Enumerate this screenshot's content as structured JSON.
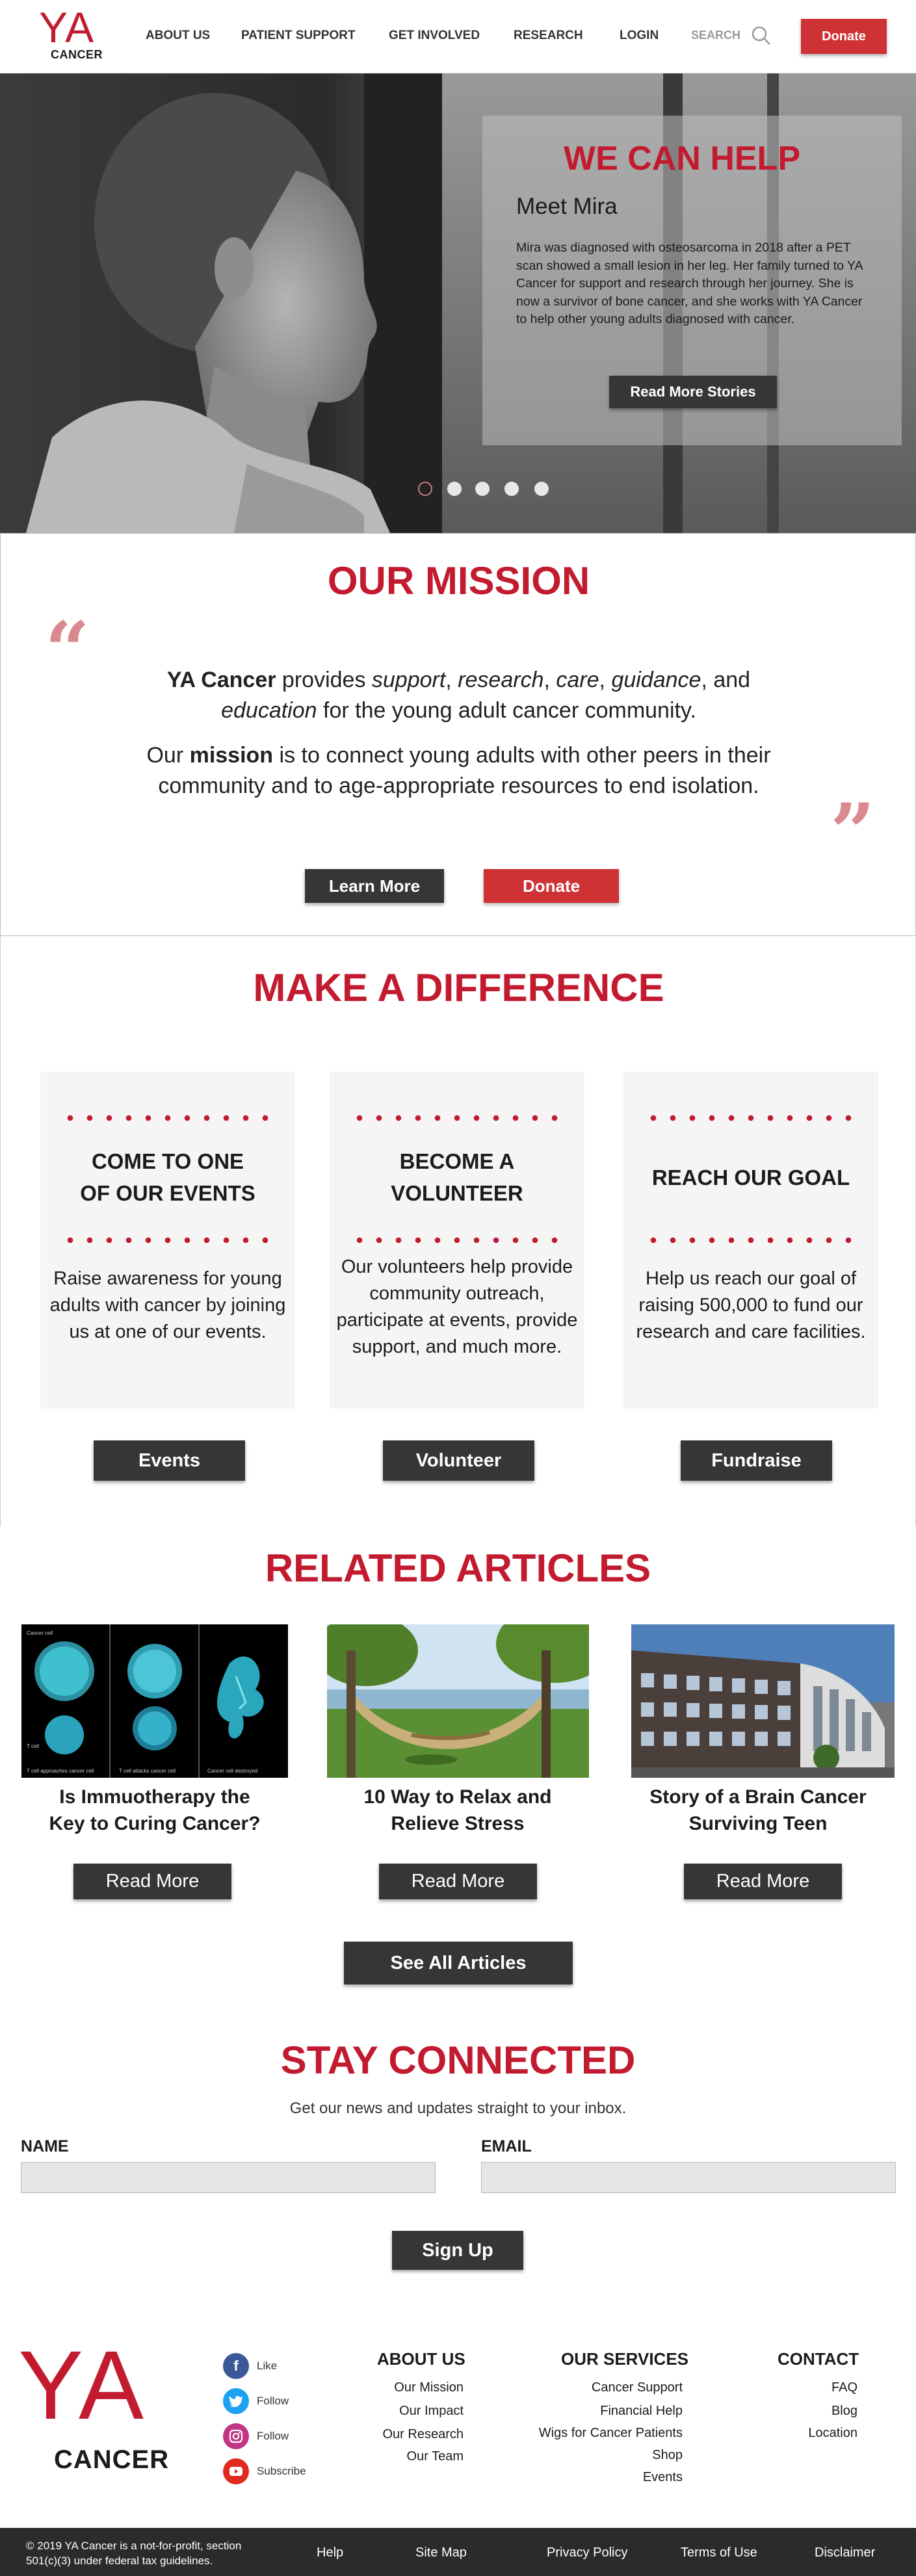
{
  "header": {
    "logo_ya": "YA",
    "logo_cancer": "CANCER",
    "nav": [
      "ABOUT US",
      "PATIENT SUPPORT",
      "GET INVOLVED",
      "RESEARCH",
      "LOGIN"
    ],
    "search_label": "SEARCH",
    "donate": "Donate"
  },
  "hero": {
    "headline": "WE CAN HELP",
    "subhead": "Meet Mira",
    "body": "Mira was diagnosed with osteosarcoma in 2018 after a PET scan showed a small lesion in her leg. Her family turned to YA Cancer for support and research through her journey. She is now a survivor of bone cancer, and she works with YA Cancer to help other young adults diagnosed with cancer.",
    "button": "Read More Stories",
    "slide_count": 5,
    "active_slide": 1
  },
  "mission": {
    "title": "OUR MISSION",
    "p1": {
      "brand": "YA Cancer",
      "t1": " provides ",
      "w1": "support",
      "s1": ", ",
      "w2": "research",
      "s2": ", ",
      "w3": "care",
      "s3": ", ",
      "w4": "guidance",
      "s4": ", and",
      "w5": "education",
      "t2": " for the young adult cancer community."
    },
    "p2": {
      "t1": "Our ",
      "bold": "mission",
      "t2": " is to connect young adults with other peers in their community and to age-appropriate resources to end isolation."
    },
    "learn_more": "Learn More",
    "donate": "Donate"
  },
  "difference": {
    "title": "MAKE A DIFFERENCE",
    "cards": [
      {
        "title_l1": "COME TO ONE",
        "title_l2": "OF OUR EVENTS",
        "text": "Raise awareness for young adults with cancer by joining us at one of our events.",
        "button": "Events"
      },
      {
        "title_l1": "BECOME A",
        "title_l2": "VOLUNTEER",
        "text": "Our volunteers help provide community outreach, participate at events, provide support, and much more.",
        "button": "Volunteer"
      },
      {
        "title_l1": "REACH OUR GOAL",
        "title_l2": "",
        "text": "Help us reach our goal of raising 500,000 to fund our research and care facilities.",
        "button": "Fundraise"
      }
    ]
  },
  "articles": {
    "title": "RELATED ARTICLES",
    "items": [
      {
        "title_l1": "Is Immuotherapy the",
        "title_l2": "Key to Curing Cancer?",
        "button": "Read More",
        "captions": [
          "Cancer cell",
          "T cell",
          "T cell approaches cancer cell",
          "T cell attacks cancer cell",
          "Cancer cell destroyed"
        ]
      },
      {
        "title_l1": "10 Way to Relax and",
        "title_l2": "Relieve Stress",
        "button": "Read More"
      },
      {
        "title_l1": "Story of a Brain Cancer",
        "title_l2": "Surviving Teen",
        "button": "Read More"
      }
    ],
    "see_all": "See All Articles"
  },
  "connected": {
    "title": "STAY CONNECTED",
    "subtitle": "Get our news and updates straight to your inbox.",
    "name_label": "NAME",
    "email_label": "EMAIL",
    "signup": "Sign Up"
  },
  "footer": {
    "logo_ya": "YA",
    "logo_cancer": "CANCER",
    "social": [
      {
        "icon": "facebook-icon",
        "label": "Like",
        "color": "#3b5998"
      },
      {
        "icon": "twitter-icon",
        "label": "Follow",
        "color": "#1da1f2"
      },
      {
        "icon": "instagram-icon",
        "label": "Follow",
        "color": "#c13584"
      },
      {
        "icon": "youtube-icon",
        "label": "Subscribe",
        "color": "#e02a20"
      }
    ],
    "about": {
      "heading": "ABOUT US",
      "links": [
        "Our Mission",
        "Our Impact",
        "Our Research",
        "Our Team"
      ]
    },
    "services": {
      "heading": "OUR SERVICES",
      "links": [
        "Cancer Support",
        "Financial Help",
        "Wigs for Cancer Patients",
        "Shop",
        "Events"
      ]
    },
    "contact": {
      "heading": "CONTACT",
      "links": [
        "FAQ",
        "Blog",
        "Location"
      ]
    }
  },
  "bottom_bar": {
    "copyright_l1": "© 2019 YA Cancer is a not-for-profit, section",
    "copyright_l2": "501(c)(3) under federal tax guidelines.",
    "links": [
      "Help",
      "Site Map",
      "Privacy Policy",
      "Terms of Use",
      "Disclaimer"
    ]
  },
  "colors": {
    "accent": "#c21b30",
    "button_dark": "#363636",
    "button_red": "#cf3234",
    "footer_bar": "#2b2b2b"
  }
}
